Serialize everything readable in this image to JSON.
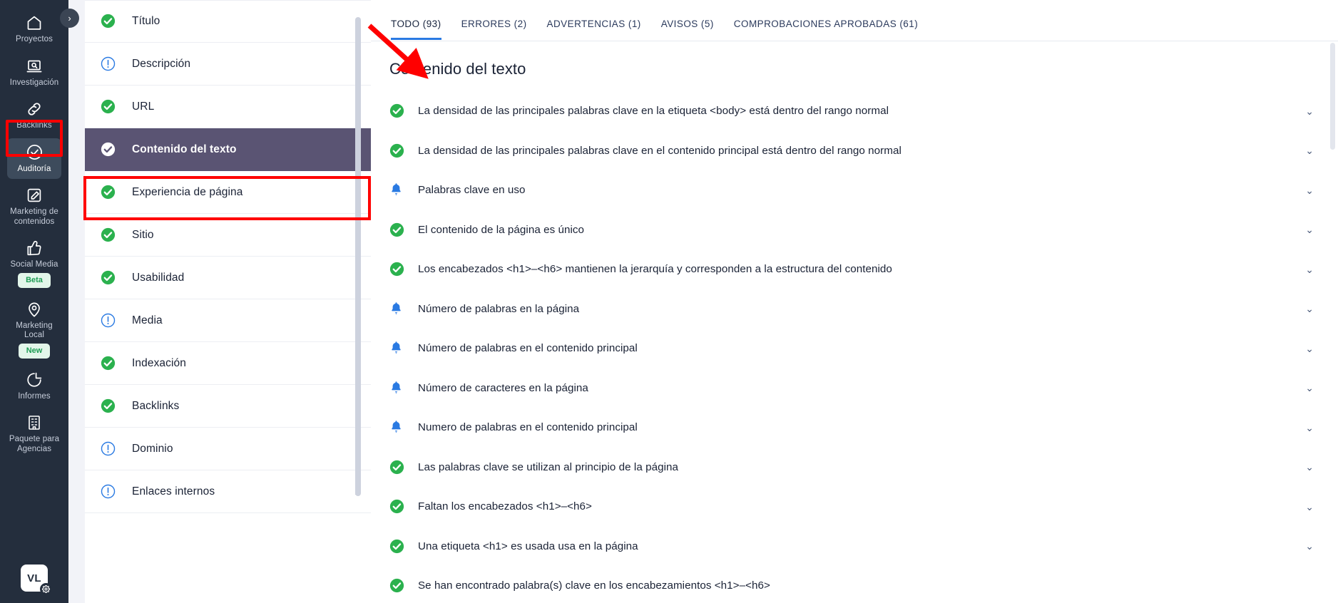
{
  "rail": {
    "items": [
      {
        "label": "Proyectos",
        "icon": "home-icon",
        "active": false,
        "badge": null
      },
      {
        "label": "Investigación",
        "icon": "research-icon",
        "active": false,
        "badge": null
      },
      {
        "label": "Backlinks",
        "icon": "link-icon",
        "active": false,
        "badge": null
      },
      {
        "label": "Auditoría",
        "icon": "check-circle-icon",
        "active": true,
        "badge": null
      },
      {
        "label": "Marketing de contenidos",
        "icon": "edit-square-icon",
        "active": false,
        "badge": null
      },
      {
        "label": "Social Media",
        "icon": "thumbs-up-icon",
        "active": false,
        "badge": "Beta"
      },
      {
        "label": "Marketing Local",
        "icon": "map-pin-icon",
        "active": false,
        "badge": "New"
      },
      {
        "label": "Informes",
        "icon": "pie-chart-icon",
        "active": false,
        "badge": null
      },
      {
        "label": "Paquete para Agencias",
        "icon": "building-icon",
        "active": false,
        "badge": null
      }
    ],
    "avatar_initials": "VL",
    "collapse_handle": "›"
  },
  "nav": {
    "items": [
      {
        "label": "Título",
        "status": "ok",
        "chevron": "›",
        "selected": false
      },
      {
        "label": "Descripción",
        "status": "info",
        "chevron": "›",
        "selected": false
      },
      {
        "label": "URL",
        "status": "ok",
        "chevron": "›",
        "selected": false
      },
      {
        "label": "Contenido del texto",
        "status": "ok",
        "chevron": "›",
        "selected": true
      },
      {
        "label": "Experiencia de página",
        "status": "ok",
        "chevron": "›",
        "selected": false
      },
      {
        "label": "Sitio",
        "status": "ok",
        "chevron": "›",
        "selected": false
      },
      {
        "label": "Usabilidad",
        "status": "ok",
        "chevron": "›",
        "selected": false
      },
      {
        "label": "Media",
        "status": "info",
        "chevron": "›",
        "selected": false
      },
      {
        "label": "Indexación",
        "status": "ok",
        "chevron": "›",
        "selected": false
      },
      {
        "label": "Backlinks",
        "status": "ok",
        "chevron": "›",
        "selected": false
      },
      {
        "label": "Dominio",
        "status": "info",
        "chevron": "›",
        "selected": false
      },
      {
        "label": "Enlaces internos",
        "status": "info",
        "chevron": "›",
        "selected": false
      }
    ]
  },
  "main": {
    "tabs": [
      {
        "label": "TODO (93)",
        "active": true
      },
      {
        "label": "ERRORES (2)",
        "active": false
      },
      {
        "label": "ADVERTENCIAS (1)",
        "active": false
      },
      {
        "label": "AVISOS (5)",
        "active": false
      },
      {
        "label": "COMPROBACIONES APROBADAS (61)",
        "active": false
      }
    ],
    "section_title": "Contenido del texto",
    "checks": [
      {
        "label": "La densidad de las principales palabras clave en la etiqueta <body> está dentro del rango normal",
        "status": "ok",
        "chevron": "⌄"
      },
      {
        "label": "La densidad de las principales palabras clave en el contenido principal está dentro del rango normal",
        "status": "ok",
        "chevron": "⌄"
      },
      {
        "label": "Palabras clave en uso",
        "status": "notice",
        "chevron": "⌄"
      },
      {
        "label": "El contenido de la página es único",
        "status": "ok",
        "chevron": "⌄"
      },
      {
        "label": "Los encabezados <h1>–<h6> mantienen la jerarquía y corresponden a la estructura del contenido",
        "status": "ok",
        "chevron": "⌄"
      },
      {
        "label": "Número de palabras en la página",
        "status": "notice",
        "chevron": "⌄"
      },
      {
        "label": "Número de palabras en el contenido principal",
        "status": "notice",
        "chevron": "⌄"
      },
      {
        "label": "Número de caracteres en la página",
        "status": "notice",
        "chevron": "⌄"
      },
      {
        "label": "Numero de palabras en el contenido principal",
        "status": "notice",
        "chevron": "⌄"
      },
      {
        "label": "Las palabras clave se utilizan al principio de la página",
        "status": "ok",
        "chevron": "⌄"
      },
      {
        "label": "Faltan los encabezados <h1>–<h6>",
        "status": "ok",
        "chevron": "⌄"
      },
      {
        "label": "Una etiqueta <h1> es usada usa en la página",
        "status": "ok",
        "chevron": "⌄"
      },
      {
        "label": "Se han encontrado palabra(s) clave en los encabezamientos <h1>–<h6>",
        "status": "ok",
        "chevron": ""
      }
    ]
  },
  "colors": {
    "rail_bg": "#242e3d",
    "rail_active": "#3d4b5c",
    "nav_selected": "#5a5473",
    "status_ok": "#2bb14e",
    "status_info": "#2a7ae2",
    "status_notice": "#2a7ae2",
    "tab_underline": "#2a7ae2",
    "annotation_red": "#ff0000",
    "badge_bg": "#e3f6ea",
    "badge_text": "#1f9d55"
  }
}
